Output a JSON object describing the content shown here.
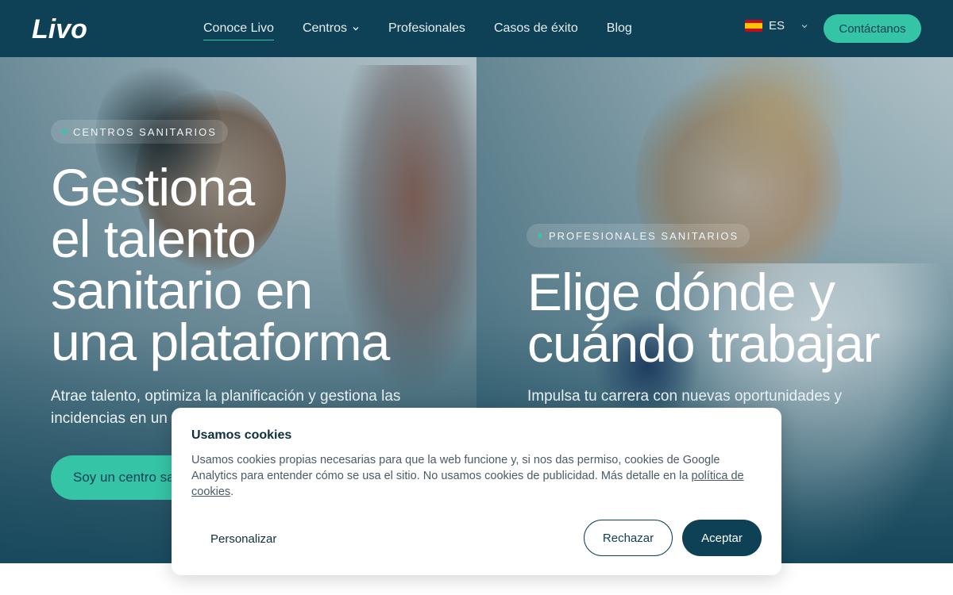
{
  "brand": {
    "logo_text": "Livo"
  },
  "nav": {
    "items": [
      {
        "label": "Conoce Livo",
        "active": true
      },
      {
        "label": "Centros",
        "has_dropdown": true
      },
      {
        "label": "Profesionales"
      },
      {
        "label": "Casos de éxito"
      },
      {
        "label": "Blog"
      }
    ],
    "language": "ES",
    "contact_label": "Contáctanos"
  },
  "hero_left": {
    "badge": "CENTROS SANITARIOS",
    "headline_lines": [
      "Gestiona",
      "el talento",
      "sanitario en",
      "una plataforma"
    ],
    "subtitle_lines": [
      "Atrae talento, optimiza la planificación y gestiona las",
      "incidencias en un"
    ],
    "cta_label": "Soy un centro sa"
  },
  "hero_right": {
    "badge": "PROFESIONALES SANITARIOS",
    "headline_lines": [
      "Elige dónde y",
      "cuándo trabajar"
    ],
    "subtitle_lines": [
      "Impulsa tu carrera con nuevas oportunidades y"
    ]
  },
  "cookie": {
    "title": "Usamos cookies",
    "text": "Usamos cookies propias necesarias para que la web funcione y, si nos das permiso, cookies de Google Analytics para entender cómo se usa el sitio. No usamos cookies de publicidad. Más detalle en la",
    "link_text": "política de cookies",
    "text_end": ".",
    "personalize_label": "Personalizar",
    "reject_label": "Rechazar",
    "accept_label": "Aceptar"
  },
  "colors": {
    "nav_bg": "#0e4156",
    "accent": "#36c4a6",
    "dark": "#0e4156"
  }
}
